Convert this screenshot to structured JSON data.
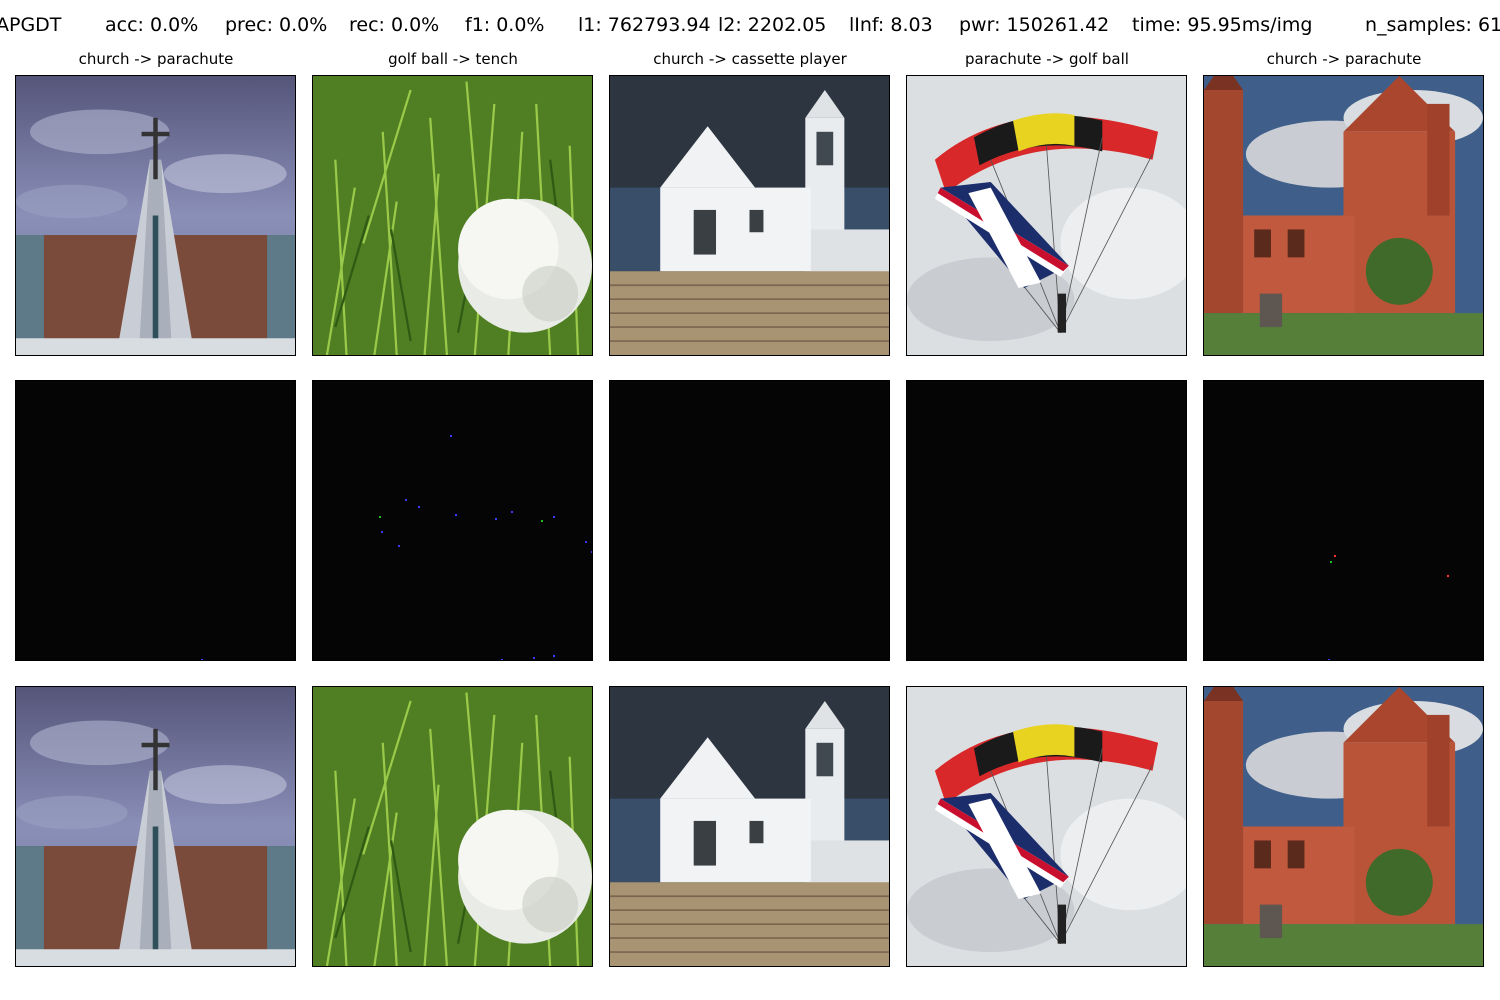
{
  "metrics": {
    "method": "APGDT",
    "acc": "acc: 0.0%",
    "prec": "prec: 0.0%",
    "rec": "rec: 0.0%",
    "f1": "f1: 0.0%",
    "l1": "l1: 762793.94",
    "l2": "l2: 2202.05",
    "linf": "lInf: 8.03",
    "pwr": "pwr: 150261.42",
    "time": "time: 95.95ms/img",
    "n_samples": "n_samples: 61"
  },
  "columns": [
    {
      "title": "church -> parachute",
      "subject": "cross-monument"
    },
    {
      "title": "golf ball -> tench",
      "subject": "golf-ball-on-grass"
    },
    {
      "title": "church -> cassette player",
      "subject": "white-church"
    },
    {
      "title": "parachute -> golf ball",
      "subject": "parachute-union-flag"
    },
    {
      "title": "church -> parachute",
      "subject": "red-brick-gothic-church"
    }
  ],
  "rows": [
    "original",
    "perturbation",
    "adversarial"
  ],
  "colors": {
    "background": "#ffffff",
    "perturbation_bg": "#050505",
    "perturbation_dots": [
      "#3a3aff",
      "#20c020",
      "#ff3030"
    ]
  }
}
